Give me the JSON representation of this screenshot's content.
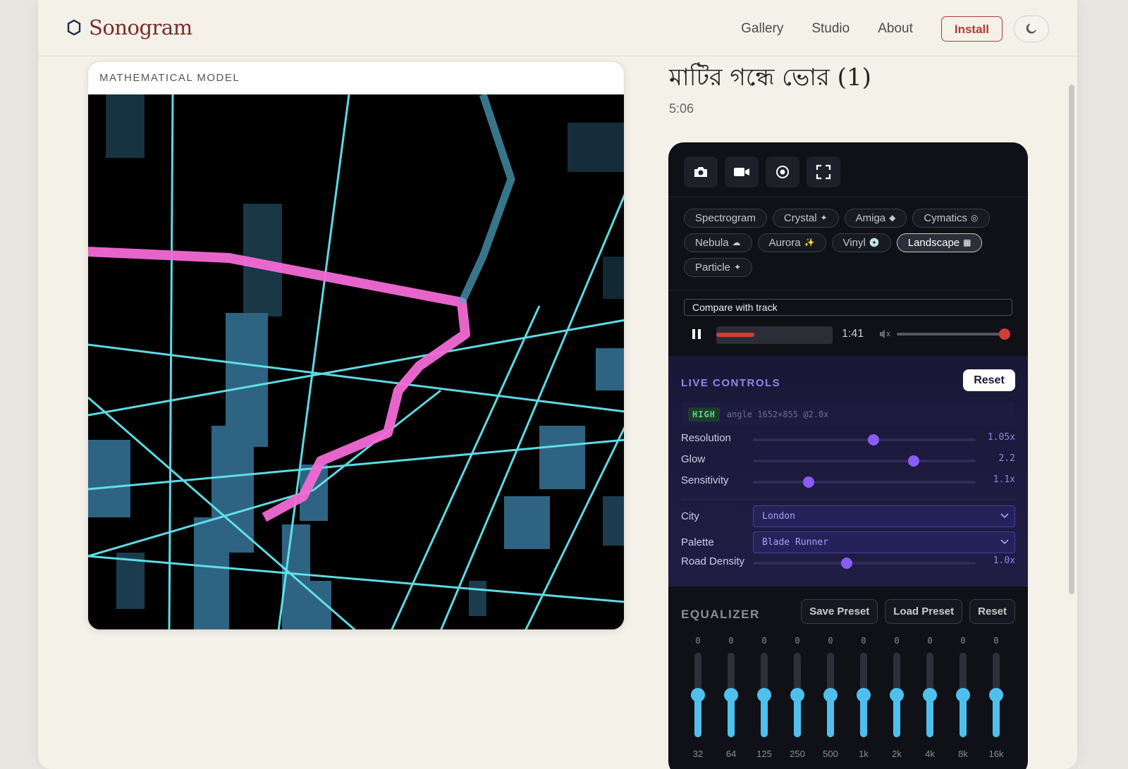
{
  "brand": {
    "name": "Sonogram",
    "icon": "hexagon-icon"
  },
  "nav": {
    "links": [
      "Gallery",
      "Studio",
      "About"
    ],
    "install_label": "Install",
    "theme_icon": "moon-icon"
  },
  "viz": {
    "header": "MATHEMATICAL MODEL"
  },
  "track": {
    "title": "মাটির গন্ধে ভোর (1)",
    "duration": "5:06"
  },
  "tools": [
    {
      "name": "screenshot-button",
      "icon": "camera-icon"
    },
    {
      "name": "record-button",
      "icon": "video-camera-icon"
    },
    {
      "name": "capture-button",
      "icon": "target-icon"
    },
    {
      "name": "fullscreen-button",
      "icon": "fullscreen-icon"
    }
  ],
  "modes": [
    {
      "label": "Spectrogram",
      "glyph": "",
      "active": false
    },
    {
      "label": "Crystal",
      "glyph": "✦",
      "active": false
    },
    {
      "label": "Amiga",
      "glyph": "◆",
      "active": false
    },
    {
      "label": "Cymatics",
      "glyph": "◎",
      "active": false
    },
    {
      "label": "Nebula",
      "glyph": "☁",
      "active": false
    },
    {
      "label": "Aurora",
      "glyph": "✨",
      "active": false
    },
    {
      "label": "Vinyl",
      "glyph": "💿",
      "active": false
    },
    {
      "label": "Landscape",
      "glyph": "▦",
      "active": true
    },
    {
      "label": "Particle",
      "glyph": "✦",
      "active": false
    }
  ],
  "compare": {
    "label": "Compare with track"
  },
  "player": {
    "time": "1:41",
    "progress": 0.33,
    "volume": 0.97,
    "accent": "#d23c3c"
  },
  "live": {
    "title": "LIVE CONTROLS",
    "reset_label": "Reset",
    "quality_badge": "HIGH",
    "quality_info": "angle 1652×855 @2.0x",
    "sliders": [
      {
        "label": "Resolution",
        "value": "1.05x",
        "fraction": 0.54
      },
      {
        "label": "Glow",
        "value": "2.2",
        "fraction": 0.72
      },
      {
        "label": "Sensitivity",
        "value": "1.1x",
        "fraction": 0.25
      }
    ],
    "city": {
      "label": "City",
      "value": "London"
    },
    "palette": {
      "label": "Palette",
      "value": "Blade Runner"
    },
    "road_density": {
      "label": "Road Density",
      "value": "1.0x",
      "fraction": 0.42
    },
    "accent": "#8a5cf6"
  },
  "eq": {
    "title": "EQUALIZER",
    "buttons": [
      "Save Preset",
      "Load Preset",
      "Reset"
    ],
    "bands": [
      {
        "freq": "32",
        "value": "0"
      },
      {
        "freq": "64",
        "value": "0"
      },
      {
        "freq": "125",
        "value": "0"
      },
      {
        "freq": "250",
        "value": "0"
      },
      {
        "freq": "500",
        "value": "0"
      },
      {
        "freq": "1k",
        "value": "0"
      },
      {
        "freq": "2k",
        "value": "0"
      },
      {
        "freq": "4k",
        "value": "0"
      },
      {
        "freq": "8k",
        "value": "0"
      },
      {
        "freq": "16k",
        "value": "0"
      }
    ],
    "accent": "#4fc0ee"
  }
}
